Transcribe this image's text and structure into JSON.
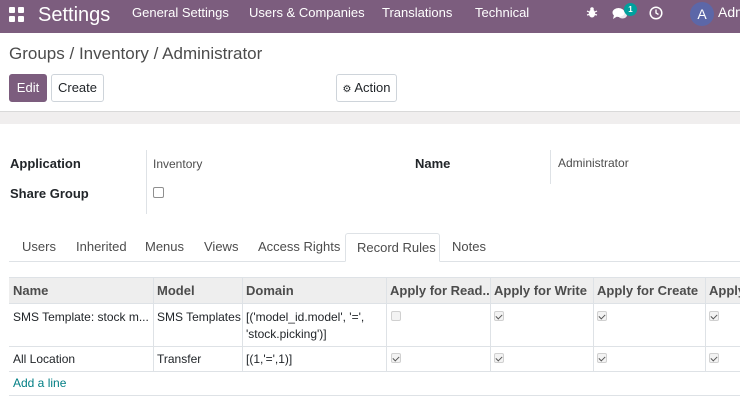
{
  "navbar": {
    "brand": "Settings",
    "menus": [
      "General Settings",
      "Users & Companies",
      "Translations",
      "Technical"
    ],
    "chat_badge": "1",
    "avatar_letter": "A",
    "user_name": "Adm",
    "bg_color": "#7c5d7e"
  },
  "breadcrumb": {
    "items": [
      "Groups",
      "Inventory",
      "Administrator"
    ],
    "sep": "/"
  },
  "buttons": {
    "edit": "Edit",
    "create": "Create",
    "action": "Action"
  },
  "form": {
    "application_label": "Application",
    "application_value": "Inventory",
    "share_group_label": "Share Group",
    "share_group_checked": false,
    "name_label": "Name",
    "name_value": "Administrator"
  },
  "tabs": [
    "Users",
    "Inherited",
    "Menus",
    "Views",
    "Access Rights",
    "Record Rules",
    "Notes"
  ],
  "active_tab": "Record Rules",
  "table": {
    "columns": [
      "Name",
      "Model",
      "Domain",
      "Apply for Read...",
      "Apply for Write",
      "Apply for Create",
      "Apply"
    ],
    "rows": [
      {
        "name": "SMS Template: stock m...",
        "model": "SMS Templates",
        "domain_line1": "[('model_id.model', '=',",
        "domain_line2": "'stock.picking')]",
        "read": false,
        "write": true,
        "create": true,
        "unlink": true
      },
      {
        "name": "All Location",
        "model": "Transfer",
        "domain_line1": "[(1,'=',1)]",
        "domain_line2": "",
        "read": true,
        "write": true,
        "create": true,
        "unlink": true
      }
    ],
    "add_line": "Add a line"
  }
}
